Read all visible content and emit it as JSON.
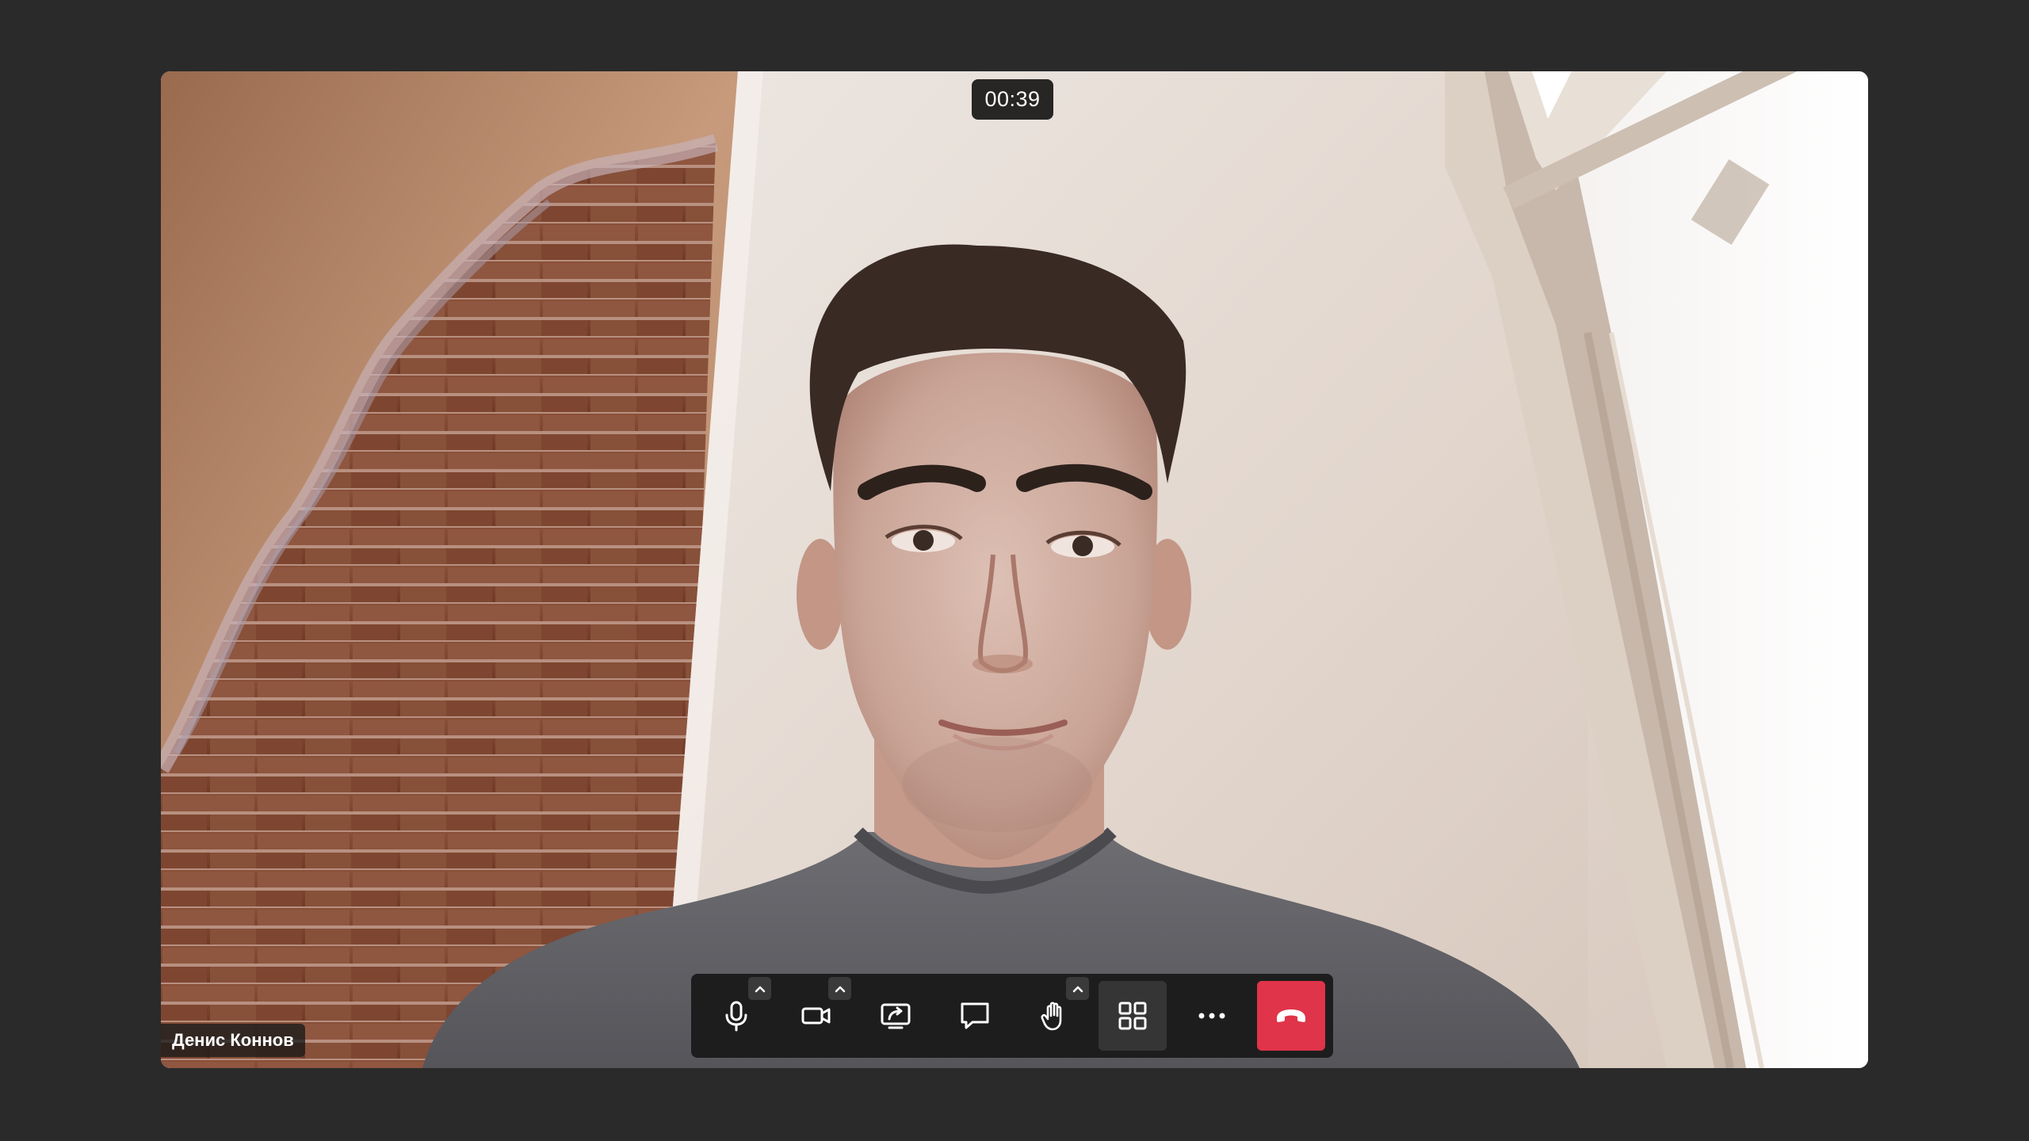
{
  "call": {
    "timer": "00:39",
    "participant_name": "Денис Коннов"
  },
  "toolbar": {
    "buttons": [
      {
        "id": "microphone",
        "icon": "microphone-icon",
        "has_menu": true
      },
      {
        "id": "camera",
        "icon": "video-camera-icon",
        "has_menu": true
      },
      {
        "id": "screen-share",
        "icon": "screen-share-icon",
        "has_menu": false
      },
      {
        "id": "chat",
        "icon": "chat-bubble-icon",
        "has_menu": false
      },
      {
        "id": "raise-hand",
        "icon": "hand-icon",
        "has_menu": true
      },
      {
        "id": "layout",
        "icon": "grid-icon",
        "has_menu": false,
        "active": true
      },
      {
        "id": "more",
        "icon": "more-horizontal-icon",
        "has_menu": false
      },
      {
        "id": "end-call",
        "icon": "phone-hangup-icon",
        "has_menu": false
      }
    ]
  },
  "colors": {
    "background": "#2a2a2b",
    "toolbar": "#1d1d1e",
    "active_button": "#353536",
    "hangup": "#e0344a",
    "icon": "#ffffff"
  }
}
